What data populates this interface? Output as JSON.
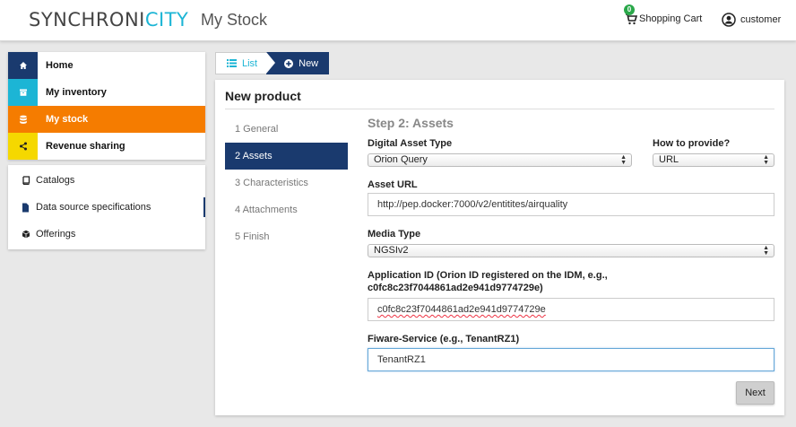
{
  "header": {
    "logo_part1": "SYNCHRONI",
    "logo_part2": "CITY",
    "app_title": "My Stock",
    "cart_count": "0",
    "cart_label": "Shopping Cart",
    "user_name": "customer"
  },
  "sidebar": {
    "main_items": [
      {
        "label": "Home",
        "icon": "home-icon",
        "color": "#1a3a6e"
      },
      {
        "label": "My inventory",
        "icon": "archive-icon",
        "color": "#1cb5d5"
      },
      {
        "label": "My stock",
        "icon": "database-icon",
        "color": "#f57c00"
      },
      {
        "label": "Revenue sharing",
        "icon": "share-icon",
        "color": "#f5d800"
      }
    ],
    "sub_items": [
      {
        "label": "Catalogs",
        "icon": "book-icon"
      },
      {
        "label": "Data source specifications",
        "icon": "file-icon"
      },
      {
        "label": "Offerings",
        "icon": "cube-icon"
      }
    ]
  },
  "tabs": {
    "list_label": "List",
    "new_label": "New"
  },
  "panel": {
    "title": "New product",
    "steps": [
      "1 General",
      "2 Assets",
      "3 Characteristics",
      "4 Attachments",
      "5 Finish"
    ],
    "step_title": "Step 2: Assets",
    "fields": {
      "asset_type_label": "Digital Asset Type",
      "asset_type_value": "Orion Query",
      "provide_label": "How to provide?",
      "provide_value": "URL",
      "asset_url_label": "Asset URL",
      "asset_url_value": "http://pep.docker:7000/v2/entitites/airquality",
      "media_type_label": "Media Type",
      "media_type_value": "NGSIv2",
      "app_id_label_line1": "Application ID (Orion ID registered on the IDM, e.g.,",
      "app_id_label_line2": "c0fc8c23f7044861ad2e941d9774729e)",
      "app_id_value": "c0fc8c23f7044861ad2e941d9774729e",
      "fiware_label": "Fiware-Service (e.g., TenantRZ1)",
      "fiware_value": "TenantRZ1"
    },
    "next_label": "Next"
  },
  "colors": {
    "primary_navy": "#1a3a6e",
    "accent_cyan": "#1cb5d5",
    "active_orange": "#f57c00",
    "yellow": "#f5d800",
    "badge_green": "#2aa84a"
  }
}
